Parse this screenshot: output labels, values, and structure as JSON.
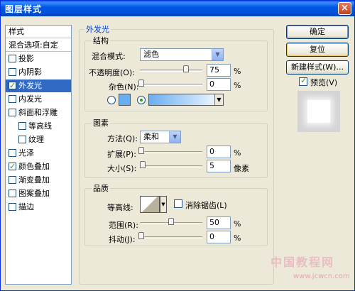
{
  "window": {
    "title": "图层样式",
    "close": "×"
  },
  "sidebar": {
    "header": "样式",
    "items": [
      {
        "label": "混合选项:自定",
        "checkbox": false,
        "checked": false,
        "indent": 0,
        "selected": false
      },
      {
        "label": "投影",
        "checkbox": true,
        "checked": false,
        "indent": 0,
        "selected": false
      },
      {
        "label": "内阴影",
        "checkbox": true,
        "checked": false,
        "indent": 0,
        "selected": false
      },
      {
        "label": "外发光",
        "checkbox": true,
        "checked": true,
        "indent": 0,
        "selected": true
      },
      {
        "label": "内发光",
        "checkbox": true,
        "checked": false,
        "indent": 0,
        "selected": false
      },
      {
        "label": "斜面和浮雕",
        "checkbox": true,
        "checked": false,
        "indent": 0,
        "selected": false
      },
      {
        "label": "等高线",
        "checkbox": true,
        "checked": false,
        "indent": 1,
        "selected": false
      },
      {
        "label": "纹理",
        "checkbox": true,
        "checked": false,
        "indent": 1,
        "selected": false
      },
      {
        "label": "光泽",
        "checkbox": true,
        "checked": false,
        "indent": 0,
        "selected": false
      },
      {
        "label": "颜色叠加",
        "checkbox": true,
        "checked": true,
        "indent": 0,
        "selected": false
      },
      {
        "label": "渐变叠加",
        "checkbox": true,
        "checked": false,
        "indent": 0,
        "selected": false
      },
      {
        "label": "图案叠加",
        "checkbox": true,
        "checked": false,
        "indent": 0,
        "selected": false
      },
      {
        "label": "描边",
        "checkbox": true,
        "checked": false,
        "indent": 0,
        "selected": false
      }
    ]
  },
  "main": {
    "title": "外发光",
    "structure": {
      "title": "结构",
      "blend_mode_label": "混合模式:",
      "blend_mode_value": "滤色",
      "opacity_label": "不透明度(O):",
      "opacity_value": "75",
      "opacity_fraction": 0.75,
      "noise_label": "杂色(N):",
      "noise_value": "0",
      "noise_fraction": 0,
      "unit": "%"
    },
    "elements": {
      "title": "图素",
      "method_label": "方法(Q):",
      "method_value": "柔和",
      "spread_label": "扩展(P):",
      "spread_value": "0",
      "spread_fraction": 0,
      "size_label": "大小(S):",
      "size_value": "5",
      "size_fraction": 0.02,
      "pct": "%",
      "px": "像素"
    },
    "quality": {
      "title": "品质",
      "contour_label": "等高线:",
      "antialias_label": "消除锯齿(L)",
      "range_label": "范围(R):",
      "range_value": "50",
      "range_fraction": 0.5,
      "jitter_label": "抖动(J):",
      "jitter_value": "0",
      "jitter_fraction": 0,
      "unit": "%"
    }
  },
  "buttons": {
    "ok": "确定",
    "reset": "复位",
    "new_style": "新建样式(W)...",
    "preview_label": "预览(V)",
    "preview_checked": true
  },
  "watermark": {
    "text": "中国教程网",
    "url": "www.jcwcn.com"
  },
  "colors": {
    "glow_color": "#6aaef2",
    "selected": "#316ac5",
    "title_blue": "#0058e6"
  }
}
